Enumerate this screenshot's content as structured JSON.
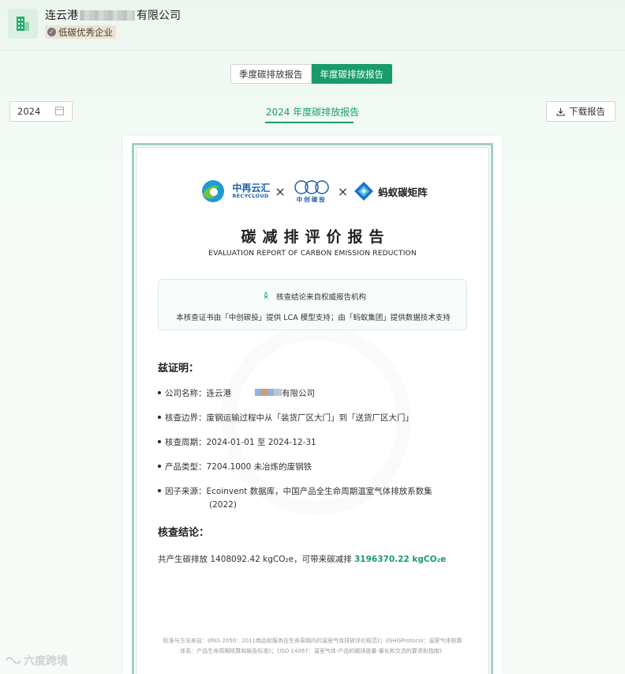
{
  "header": {
    "company_prefix": "连云港",
    "company_suffix": "有限公司",
    "badge": "低碳优秀企业"
  },
  "tabs": [
    {
      "label": "季度碳排放报告",
      "active": false
    },
    {
      "label": "年度碳排放报告",
      "active": true
    }
  ],
  "toolbar": {
    "year": "2024",
    "report_heading": "2024 年度碳排放报告",
    "download_label": "下载报告"
  },
  "certificate": {
    "partners": {
      "p1_cn": "中再云汇",
      "p1_en": "RECYCLOUD",
      "p2_cn": "中创碳投",
      "p3": "蚂蚁碳矩阵",
      "sep": "×"
    },
    "title": "碳减排评价报告",
    "subtitle": "EVALUATION REPORT OF CARBON EMISSION REDUCTION",
    "notice_title": "核查结论来自权威报告机构",
    "notice_text": "本核查证书由「中创碳投」提供 LCA 模型支持；由「蚂蚁集团」提供数据技术支持",
    "certify_title": "兹证明：",
    "items": {
      "company_label": "公司名称：",
      "company_value_prefix": "连云港",
      "company_value_suffix": "有限公司",
      "boundary": "核查边界：废钢运输过程中从「装货厂区大门」到「送货厂区大门」",
      "period": "核查周期：2024-01-01 至 2024-12-31",
      "product": "产品类型：7204.1000 未冶炼的废钢铁",
      "factor": "因子来源：Ecoinvent 数据库，中国产品全生命周期温室气体排放系数集",
      "factor_cont": "(2022)"
    },
    "conclusion_title": "核查结论：",
    "conclusion_prefix": "共产生碳排放 1408092.42 kgCO₂e，可带来碳减排 ",
    "conclusion_value": "3196370.22 kgCO₂e",
    "footer_line1": "标准与方法来自：《PAS 2050：2011商品和服务在生命周期内的温室气体排放评价规范》；《GHGProtocol：温室气体核算",
    "footer_line2": "体系：产品生命周期核算和报告标准》；《ISO 14067：温室气体-产品的碳排放量-量化和交流的要求和指南》"
  },
  "watermark": "六度跨境",
  "colors": {
    "accent": "#1a9b6c",
    "badge_bg": "#ece3d2",
    "frame": "#9fd2bd"
  }
}
